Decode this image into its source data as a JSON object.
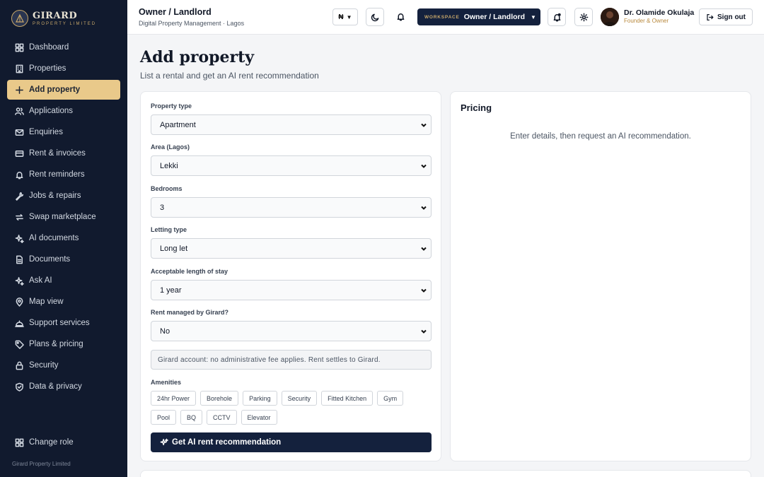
{
  "brand": {
    "name": "GIRARD",
    "sub": "PROPERTY LIMITED"
  },
  "sidebar": {
    "items": [
      {
        "label": "Dashboard",
        "icon": "grid-icon"
      },
      {
        "label": "Properties",
        "icon": "building-icon"
      },
      {
        "label": "Add property",
        "icon": "plus-icon",
        "active": true
      },
      {
        "label": "Applications",
        "icon": "users-icon"
      },
      {
        "label": "Enquiries",
        "icon": "mail-icon"
      },
      {
        "label": "Rent & invoices",
        "icon": "card-icon"
      },
      {
        "label": "Rent reminders",
        "icon": "bell-icon"
      },
      {
        "label": "Jobs & repairs",
        "icon": "wrench-icon"
      },
      {
        "label": "Swap marketplace",
        "icon": "swap-icon"
      },
      {
        "label": "AI documents",
        "icon": "sparkle-icon"
      },
      {
        "label": "Documents",
        "icon": "document-icon"
      },
      {
        "label": "Ask AI",
        "icon": "sparkle-icon"
      },
      {
        "label": "Map view",
        "icon": "map-pin-icon"
      },
      {
        "label": "Support services",
        "icon": "service-bell-icon"
      },
      {
        "label": "Plans & pricing",
        "icon": "tag-icon"
      },
      {
        "label": "Security",
        "icon": "lock-icon"
      },
      {
        "label": "Data & privacy",
        "icon": "shield-icon"
      }
    ],
    "change_role": "Change role",
    "footer": "Girard Property Limited"
  },
  "header": {
    "title": "Owner / Landlord",
    "subtitle": "Digital Property Management · Lagos",
    "currency": "₦",
    "workspace_label": "WORKSPACE",
    "workspace_value": "Owner / Landlord",
    "user_name": "Dr. Olamide Okulaja",
    "user_role": "Founder & Owner",
    "sign_out": "Sign out"
  },
  "page": {
    "title": "Add property",
    "subtitle": "List a rental and get an AI rent recommendation"
  },
  "form": {
    "property_type": {
      "label": "Property type",
      "value": "Apartment"
    },
    "area": {
      "label": "Area (Lagos)",
      "value": "Lekki"
    },
    "bedrooms": {
      "label": "Bedrooms",
      "value": "3"
    },
    "letting_type": {
      "label": "Letting type",
      "value": "Long let"
    },
    "stay_length": {
      "label": "Acceptable length of stay",
      "value": "1 year"
    },
    "managed": {
      "label": "Rent managed by Girard?",
      "value": "No"
    },
    "note": "Girard account: no administrative fee applies. Rent settles to Girard.",
    "amenities_label": "Amenities",
    "amenities": [
      "24hr Power",
      "Borehole",
      "Parking",
      "Security",
      "Fitted Kitchen",
      "Gym",
      "Pool",
      "BQ",
      "CCTV",
      "Elevator"
    ],
    "cta": "Get AI rent recommendation"
  },
  "pricing": {
    "title": "Pricing",
    "empty": "Enter details, then request an AI recommendation."
  },
  "colors": {
    "sidebar_bg": "#111a2e",
    "accent": "#e9c98a",
    "primary": "#14213d"
  }
}
